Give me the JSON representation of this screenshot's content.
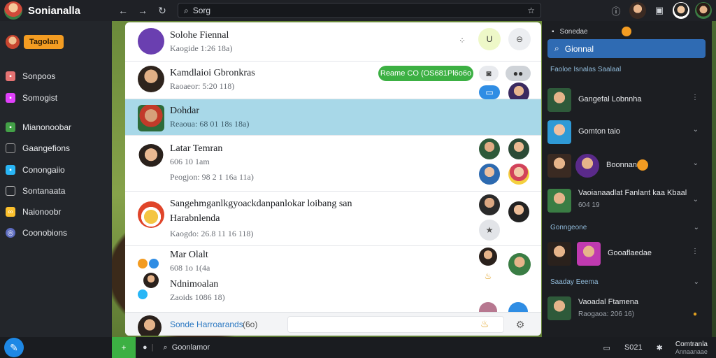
{
  "app": {
    "title": "Sonianalla"
  },
  "topbar": {
    "search_value": "Sorg",
    "back_icon": "arrow-left-icon",
    "forward_icon": "arrow-right-icon",
    "refresh_icon": "refresh-icon"
  },
  "sidebar": {
    "workspace_label": "Tagolan",
    "items": [
      {
        "label": "Sonpoos",
        "icon": "bookmark-icon",
        "color": "#e57373"
      },
      {
        "label": "Somogist",
        "icon": "tag-icon",
        "color": "#e040fb"
      },
      {
        "label": "Mianonoobar",
        "icon": "android-icon",
        "color": "#43a047"
      },
      {
        "label": "Gaangefions",
        "icon": "doc-icon",
        "color": "#9e9e9e"
      },
      {
        "label": "Conongaiio",
        "icon": "grid-icon",
        "color": "#29b6f6"
      },
      {
        "label": "Sontanaata",
        "icon": "list-icon",
        "color": "#bdbdbd"
      },
      {
        "label": "Naionoobr",
        "icon": "link-icon",
        "color": "#fbc02d"
      },
      {
        "label": "Coonobions",
        "icon": "globe-icon",
        "color": "#5c6bc0"
      }
    ]
  },
  "conversations": [
    {
      "name": "Solohe Fiennal",
      "sub": "Kaogide 1:26 18a)"
    },
    {
      "name": "Kamdlaioi Gbronkras",
      "sub": "Raoaeor: 5:20 118)",
      "pill": "Reame CO (OS681Pl6o6o"
    },
    {
      "name": "Dohdar",
      "sub": "Reaoua: 68 01 18s 18a)"
    },
    {
      "name": "Latar Temran",
      "sub": "606 10 1am",
      "sub2": "Peogjon: 98 2 1 16a 11a)"
    },
    {
      "name": "Sangehmganlkgyoackdanpanlokar loibang san",
      "sub": "Harabnlenda",
      "sub2": "Kaogdo: 26.8 11 16 118)"
    },
    {
      "name": "Mar Olalt",
      "sub": "608 1o 1(4a",
      "sub2": "Ndnimoalan",
      "sub3": "Zaoids 1086 18)"
    }
  ],
  "footer": {
    "name": "Sonde Harroarands",
    "count": "(6o)"
  },
  "right_panel": {
    "header": "Sonedae",
    "search_value": "Gionnal",
    "section1": "Faoloe Isnalas Saalaal",
    "rows": [
      {
        "name": "Gangefal Lobnnha"
      },
      {
        "name": "Gomton taio"
      },
      {
        "name": "Boonnan"
      },
      {
        "name": "Vaoianaadlat Fanlant kaa Kbaal",
        "sub": "604 19"
      }
    ],
    "section2": "Gonngeone",
    "row5": "Gooaflaedae",
    "section3": "Saaday Eeema",
    "row6": {
      "name": "Vaoadal Ftamena",
      "sub": "Raogaoa: 206 16)"
    }
  },
  "bottombar": {
    "search_label": "Goonlamor",
    "count": "S021",
    "user_name": "Comtranla",
    "user_sub": "Annaanaae"
  },
  "colors": {
    "accent_blue": "#2f6bb3",
    "selected_row": "#a8d8e8",
    "workspace_orange": "#f39c22",
    "green_pill": "#3cb043"
  }
}
